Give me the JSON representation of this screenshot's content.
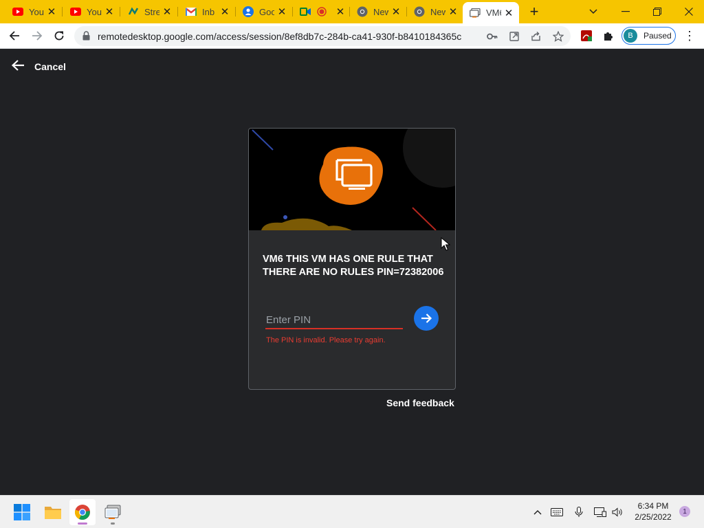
{
  "browser": {
    "tabs": [
      {
        "label": "You",
        "icon": "youtube-icon"
      },
      {
        "label": "You",
        "icon": "youtube-icon"
      },
      {
        "label": "Stre",
        "icon": "stream-icon"
      },
      {
        "label": "Inb",
        "icon": "gmail-icon"
      },
      {
        "label": "Goo",
        "icon": "google-account-icon"
      },
      {
        "label": "",
        "icon": "meet-icon"
      },
      {
        "label": "New",
        "icon": "chrome-icon"
      },
      {
        "label": "New",
        "icon": "chrome-icon"
      },
      {
        "label": "VM6",
        "icon": "remote-desktop-icon",
        "active": true
      }
    ],
    "url": "remotedesktop.google.com/access/session/8ef8db7c-284b-ca41-930f-b8410184365c",
    "profile_initial": "B",
    "profile_status": "Paused",
    "tabstrip_color": "#f6c500"
  },
  "page": {
    "cancel_label": "Cancel",
    "host_title": "VM6 THIS VM HAS ONE RULE THAT THERE ARE NO RULES PIN=72382006",
    "pin_placeholder": "Enter PIN",
    "pin_error": "The PIN is invalid. Please try again.",
    "feedback_label": "Send feedback",
    "accent_color": "#1a73e8",
    "error_color": "#ea3c31",
    "brand_orange": "#e8710a"
  },
  "taskbar": {
    "time": "6:34 PM",
    "date": "2/25/2022",
    "notification_count": "1",
    "apps": [
      "windows-start-icon",
      "file-explorer-icon",
      "chrome-icon",
      "remote-desktop-icon"
    ]
  }
}
